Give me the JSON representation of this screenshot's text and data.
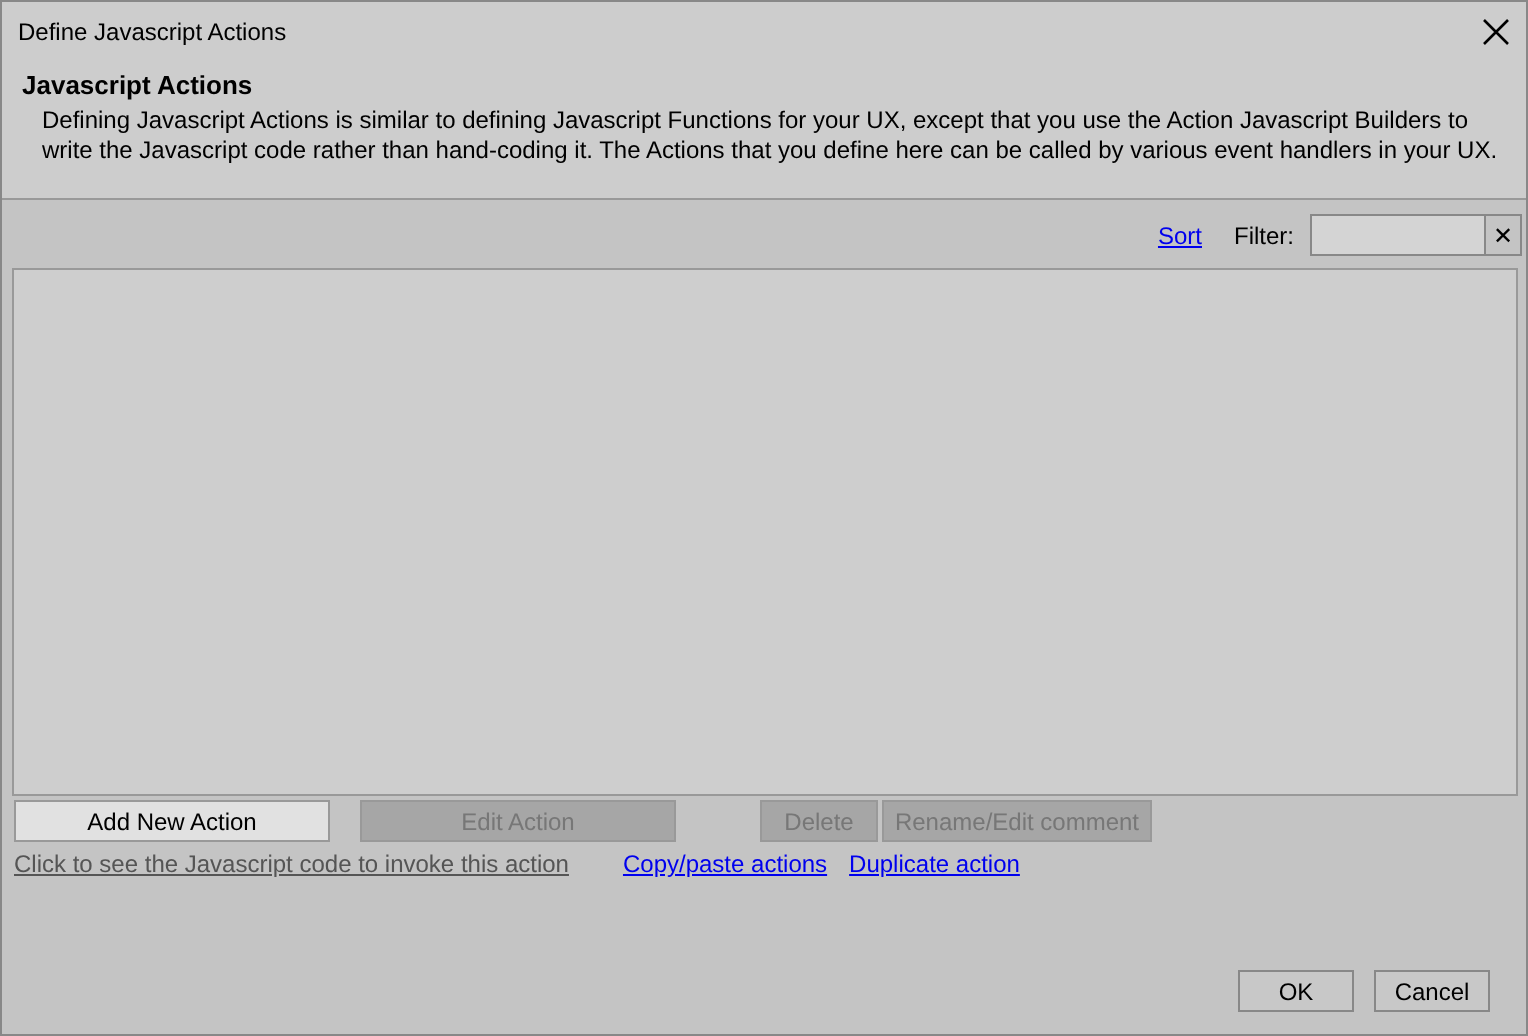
{
  "window": {
    "title": "Define Javascript Actions"
  },
  "header": {
    "title": "Javascript Actions",
    "description": "Defining Javascript Actions is similar to defining Javascript Functions for your UX, except that you use the Action Javascript Builders to write the Javascript code rather than hand-coding it. The Actions that you define here can be called by various event handlers in your UX."
  },
  "toolbar": {
    "sort_link": "Sort",
    "filter_label": "Filter:",
    "clear_button": "✕"
  },
  "action_buttons": [
    {
      "label": "Add New Action",
      "disabled": false
    },
    {
      "label": "Edit Action",
      "disabled": true
    },
    {
      "label": "Delete",
      "disabled": true
    },
    {
      "label": "Rename/Edit comment",
      "disabled": true
    }
  ],
  "links": [
    {
      "label": "Click to see the Javascript code to invoke this action",
      "disabled": true
    },
    {
      "label": "Copy/paste actions",
      "disabled": false
    },
    {
      "label": "Duplicate action",
      "disabled": false
    }
  ],
  "dialog_buttons": [
    "OK",
    "Cancel"
  ]
}
